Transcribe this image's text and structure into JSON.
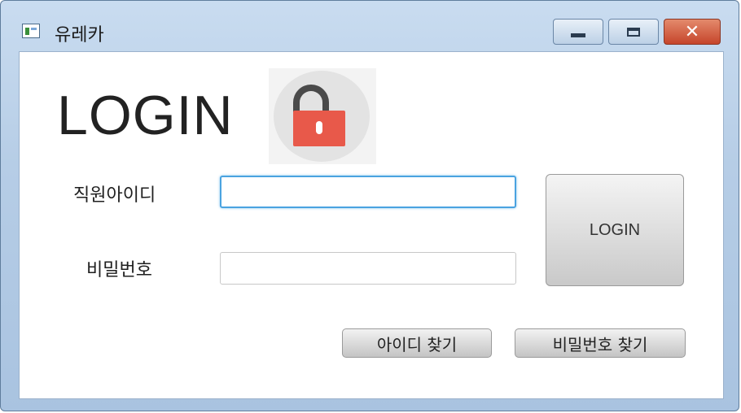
{
  "window": {
    "title": "유레카",
    "controls": {
      "minimize": "minimize",
      "maximize": "maximize",
      "close": "✕"
    }
  },
  "header": {
    "heading": "LOGIN"
  },
  "form": {
    "id_label": "직원아이디",
    "id_value": "",
    "password_label": "비밀번호",
    "password_value": ""
  },
  "buttons": {
    "login": "LOGIN",
    "find_id": "아이디 찾기",
    "find_password": "비밀번호 찾기"
  },
  "icons": {
    "app": "app-icon",
    "lock": "unlocked-padlock-icon"
  },
  "colors": {
    "lock_body": "#e8594a",
    "focus_border": "#4aa3e0"
  }
}
